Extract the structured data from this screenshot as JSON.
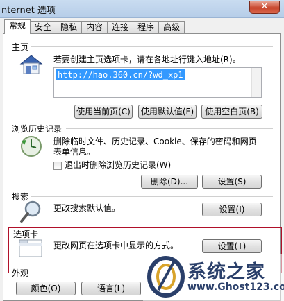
{
  "window": {
    "title": "nternet 选项",
    "close_label": "✕"
  },
  "tabs": [
    {
      "label": "常规",
      "active": true
    },
    {
      "label": "安全",
      "active": false
    },
    {
      "label": "隐私",
      "active": false
    },
    {
      "label": "内容",
      "active": false
    },
    {
      "label": "连接",
      "active": false
    },
    {
      "label": "程序",
      "active": false
    },
    {
      "label": "高级",
      "active": false
    }
  ],
  "homepage": {
    "title": "主页",
    "description": "若要创建主页选项卡，请在各地址行键入地址(R)。",
    "url_value": "http://hao.360.cn/?wd_xp1",
    "use_current_label": "使用当前页(C)",
    "use_default_label": "使用默认值(F)",
    "use_blank_label": "使用空白页(B)",
    "icon": "house-icon"
  },
  "history": {
    "title": "浏览历史记录",
    "description": "删除临时文件、历史记录、Cookie、保存的密码和网页表单信息。",
    "checkbox_label": "退出时删除浏览历史记录(W)",
    "checkbox_checked": false,
    "delete_label": "删除(D)...",
    "settings_label": "设置(S)",
    "icon": "history-clock-icon"
  },
  "search": {
    "title": "搜索",
    "description": "更改搜索默认值。",
    "settings_label": "设置(I)",
    "icon": "magnifier-icon"
  },
  "tabs_section": {
    "title": "选项卡",
    "description": "更改网页在选项卡中显示的方式。",
    "settings_label": "设置(T)",
    "icon": "tab-window-icon"
  },
  "appearance": {
    "title": "外观",
    "colors_label": "颜色(O)",
    "languages_label": "语言(L)"
  },
  "watermark": {
    "title": "系统之家",
    "url": "www.Ghost123.com"
  },
  "colors": {
    "selection": "#3399ff",
    "highlight_border": "#b0102a",
    "watermark": "#2a3f6a"
  }
}
